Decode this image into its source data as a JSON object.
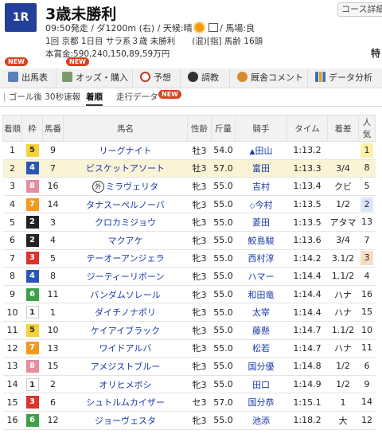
{
  "header": {
    "race_num": "1R",
    "race_name": "3歳未勝利",
    "course_button": "コース詳細",
    "start_time": "09:50発走",
    "course": "/ ダ1200m (右)",
    "weather_label": "/ 天候:晴",
    "track_label": "/ 馬場:良",
    "line2": "1回 京都 1日目 サラ系３歳 未勝利　　(混)[指] 馬齢 16頭",
    "line3": "本賞金:590,240,150,89,59万円",
    "tokusen": "特"
  },
  "badges": {
    "new": "NEW"
  },
  "tabs": [
    {
      "label": "出馬表",
      "color": "#5b7fb8"
    },
    {
      "label": "オッズ・購入",
      "color": "#7d9a6b"
    },
    {
      "label": "予想",
      "color": "#c0392b"
    },
    {
      "label": "調教",
      "color": "#333333"
    },
    {
      "label": "厩舎コメント",
      "color": "#d98b2b"
    },
    {
      "label": "データ分析",
      "color": "#3a6fb8"
    }
  ],
  "subtabs": [
    {
      "label": "ゴール後 30秒速報"
    },
    {
      "label": "着順"
    },
    {
      "label": "走行データ"
    }
  ],
  "columns": {
    "rank": "着順",
    "waku": "枠",
    "num": "馬番",
    "name": "馬名",
    "sexage": "性齢",
    "weight": "斤量",
    "jockey": "騎手",
    "time": "タイム",
    "margin": "着差",
    "pop": "人気"
  },
  "rows": [
    {
      "rank": "1",
      "waku": "5",
      "num": "9",
      "name": "リーグナイト",
      "sexage": "牡3",
      "weight": "54.0",
      "jmark": "▲",
      "jockey": "田山",
      "time": "1:13.2",
      "margin": "",
      "pop": "1"
    },
    {
      "rank": "2",
      "waku": "4",
      "num": "7",
      "name": "ビスケットアソート",
      "sexage": "牡3",
      "weight": "57.0",
      "jmark": "",
      "jockey": "富田",
      "time": "1:13.3",
      "margin": "3/4",
      "pop": "8"
    },
    {
      "rank": "3",
      "waku": "8",
      "num": "16",
      "prefix": "外",
      "name": "ミラヴェリタ",
      "sexage": "牝3",
      "weight": "55.0",
      "jmark": "",
      "jockey": "吉村",
      "time": "1:13.4",
      "margin": "クビ",
      "pop": "5"
    },
    {
      "rank": "4",
      "waku": "7",
      "num": "14",
      "name": "タナスーペルノーバ",
      "sexage": "牝3",
      "weight": "55.0",
      "jmark": "◇",
      "jockey": "今村",
      "time": "1:13.5",
      "margin": "1/2",
      "pop": "2"
    },
    {
      "rank": "5",
      "waku": "2",
      "num": "3",
      "name": "クロカミジョウ",
      "sexage": "牝3",
      "weight": "55.0",
      "jmark": "",
      "jockey": "菱田",
      "time": "1:13.5",
      "margin": "アタマ",
      "pop": "13"
    },
    {
      "rank": "6",
      "waku": "2",
      "num": "4",
      "name": "マクアケ",
      "sexage": "牝3",
      "weight": "55.0",
      "jmark": "",
      "jockey": "鮫島駿",
      "time": "1:13.6",
      "margin": "3/4",
      "pop": "7"
    },
    {
      "rank": "7",
      "waku": "3",
      "num": "5",
      "name": "テーオーアンジェラ",
      "sexage": "牝3",
      "weight": "55.0",
      "jmark": "",
      "jockey": "西村淳",
      "time": "1:14.2",
      "margin": "3.1/2",
      "pop": "3"
    },
    {
      "rank": "8",
      "waku": "4",
      "num": "8",
      "name": "ジーティーリボーン",
      "sexage": "牝3",
      "weight": "55.0",
      "jmark": "",
      "jockey": "ハマー",
      "time": "1:14.4",
      "margin": "1.1/2",
      "pop": "4"
    },
    {
      "rank": "9",
      "waku": "6",
      "num": "11",
      "name": "バンダムソレール",
      "sexage": "牝3",
      "weight": "55.0",
      "jmark": "",
      "jockey": "和田竜",
      "time": "1:14.4",
      "margin": "ハナ",
      "pop": "16"
    },
    {
      "rank": "10",
      "waku": "1",
      "num": "1",
      "name": "ダイチノナポリ",
      "sexage": "牝3",
      "weight": "55.0",
      "jmark": "",
      "jockey": "太宰",
      "time": "1:14.4",
      "margin": "ハナ",
      "pop": "15"
    },
    {
      "rank": "11",
      "waku": "5",
      "num": "10",
      "name": "ケイアイブラック",
      "sexage": "牝3",
      "weight": "55.0",
      "jmark": "",
      "jockey": "藤懸",
      "time": "1:14.7",
      "margin": "1.1/2",
      "pop": "10"
    },
    {
      "rank": "12",
      "waku": "7",
      "num": "13",
      "name": "ワイドアルバ",
      "sexage": "牝3",
      "weight": "55.0",
      "jmark": "",
      "jockey": "松若",
      "time": "1:14.7",
      "margin": "ハナ",
      "pop": "11"
    },
    {
      "rank": "13",
      "waku": "8",
      "num": "15",
      "name": "アメジストブルー",
      "sexage": "牝3",
      "weight": "55.0",
      "jmark": "",
      "jockey": "国分優",
      "time": "1:14.8",
      "margin": "1/2",
      "pop": "6"
    },
    {
      "rank": "14",
      "waku": "1",
      "num": "2",
      "name": "オリヒメボシ",
      "sexage": "牝3",
      "weight": "55.0",
      "jmark": "",
      "jockey": "田口",
      "time": "1:14.9",
      "margin": "1/2",
      "pop": "9"
    },
    {
      "rank": "15",
      "waku": "3",
      "num": "6",
      "name": "シュトルムカイザー",
      "sexage": "セ3",
      "weight": "57.0",
      "jmark": "",
      "jockey": "国分恭",
      "time": "1:15.1",
      "margin": "1",
      "pop": "14"
    },
    {
      "rank": "16",
      "waku": "6",
      "num": "12",
      "name": "ジョーヴェスタ",
      "sexage": "牝3",
      "weight": "55.0",
      "jmark": "",
      "jockey": "池添",
      "time": "1:18.2",
      "margin": "大",
      "pop": "12"
    }
  ]
}
